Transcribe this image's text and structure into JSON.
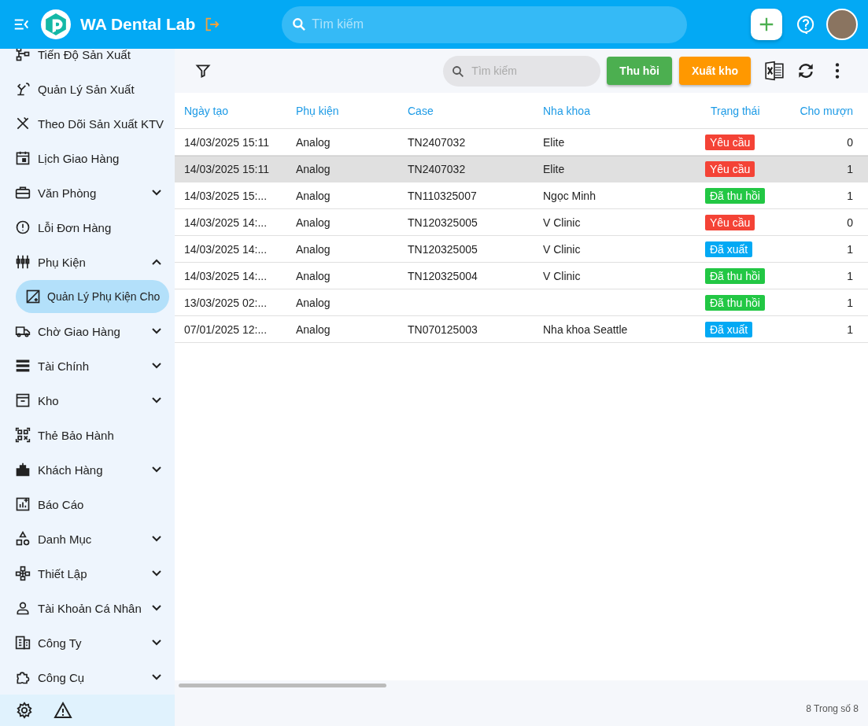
{
  "header": {
    "title": "WA Dental Lab",
    "search": {
      "placeholder": "Tìm kiếm"
    }
  },
  "sidebar": {
    "items": [
      {
        "label": "Tiến Độ Sản Xuất"
      },
      {
        "label": "Quản Lý Sản Xuất"
      },
      {
        "label": "Theo Dõi Sản Xuất KTV"
      },
      {
        "label": "Lịch Giao Hàng"
      },
      {
        "label": "Văn Phòng",
        "expanded": false
      },
      {
        "label": "Lỗi Đơn Hàng"
      },
      {
        "label": "Phụ Kiện",
        "expanded": true,
        "children": [
          {
            "label": "Quản Lý Phụ Kiện Cho",
            "selected": true
          }
        ]
      },
      {
        "label": "Chờ Giao Hàng",
        "expanded": false
      },
      {
        "label": "Tài Chính",
        "expanded": false
      },
      {
        "label": "Kho",
        "expanded": false
      },
      {
        "label": "Thẻ Bảo Hành"
      },
      {
        "label": "Khách Hàng",
        "expanded": false
      },
      {
        "label": "Báo Cáo"
      },
      {
        "label": "Danh Mục",
        "expanded": false
      },
      {
        "label": "Thiết Lập",
        "expanded": false
      },
      {
        "label": "Tài Khoản Cá Nhân",
        "expanded": false
      },
      {
        "label": "Công Ty",
        "expanded": false
      },
      {
        "label": "Công Cụ",
        "expanded": false
      }
    ]
  },
  "toolbar": {
    "search": {
      "placeholder": "Tìm kiếm"
    },
    "buttons": [
      {
        "label": "Thu hồi",
        "kind": "recall"
      },
      {
        "label": "Xuất kho",
        "kind": "export"
      }
    ]
  },
  "table": {
    "columns": [
      "Ngày tạo",
      "Phụ kiện",
      "Case",
      "Nha khoa",
      "Trạng thái",
      "Cho mượn"
    ],
    "rows": [
      {
        "date": "14/03/2025 15:11",
        "accessory": "Analog",
        "case": "TN2407032",
        "clinic": "Elite",
        "status": {
          "label": "Yêu cầu",
          "color": "#f44336"
        },
        "loan": "0",
        "selected": false
      },
      {
        "date": "14/03/2025 15:11",
        "accessory": "Analog",
        "case": "TN2407032",
        "clinic": "Elite",
        "status": {
          "label": "Yêu cầu",
          "color": "#f44336"
        },
        "loan": "1",
        "selected": true
      },
      {
        "date": "14/03/2025 15:...",
        "accessory": "Analog",
        "case": "TN110325007",
        "clinic": "Ngọc Minh",
        "status": {
          "label": "Đã thu hồi",
          "color": "#22c744"
        },
        "loan": "1",
        "selected": false
      },
      {
        "date": "14/03/2025 14:...",
        "accessory": "Analog",
        "case": "TN120325005",
        "clinic": "V Clinic",
        "status": {
          "label": "Yêu cầu",
          "color": "#f44336"
        },
        "loan": "0",
        "selected": false
      },
      {
        "date": "14/03/2025 14:...",
        "accessory": "Analog",
        "case": "TN120325005",
        "clinic": "V Clinic",
        "status": {
          "label": "Đã xuất",
          "color": "#03a9f4"
        },
        "loan": "1",
        "selected": false
      },
      {
        "date": "14/03/2025 14:...",
        "accessory": "Analog",
        "case": "TN120325004",
        "clinic": "V Clinic",
        "status": {
          "label": "Đã thu hồi",
          "color": "#22c744"
        },
        "loan": "1",
        "selected": false
      },
      {
        "date": "13/03/2025 02:...",
        "accessory": "Analog",
        "status": {
          "label": "Đã thu hồi",
          "color": "#22c744"
        },
        "loan": "1",
        "selected": false
      },
      {
        "date": "07/01/2025 12:...",
        "accessory": "Analog",
        "case": "TN070125003",
        "clinic": "Nha khoa Seattle",
        "status": {
          "label": "Đã xuất",
          "color": "#03a9f4"
        },
        "loan": "1",
        "selected": false
      }
    ]
  },
  "footer": {
    "count": "8 Trong số 8"
  }
}
